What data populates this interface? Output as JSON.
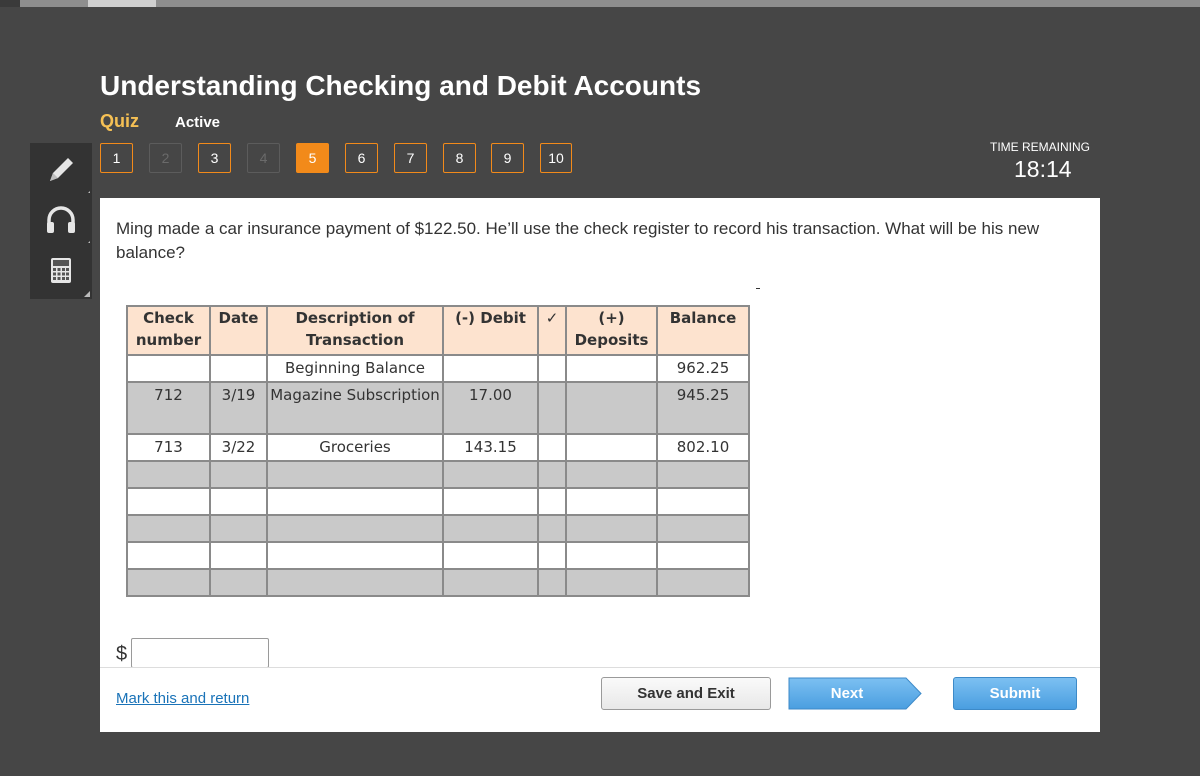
{
  "header": {
    "title": "Understanding Checking and Debit Accounts",
    "section_label": "Quiz",
    "status_label": "Active"
  },
  "question_nav": [
    {
      "label": "1",
      "state": "answered"
    },
    {
      "label": "2",
      "state": "disabled"
    },
    {
      "label": "3",
      "state": "answered"
    },
    {
      "label": "4",
      "state": "disabled"
    },
    {
      "label": "5",
      "state": "current"
    },
    {
      "label": "6",
      "state": "answered"
    },
    {
      "label": "7",
      "state": "answered"
    },
    {
      "label": "8",
      "state": "answered"
    },
    {
      "label": "9",
      "state": "answered"
    },
    {
      "label": "10",
      "state": "answered"
    }
  ],
  "timer": {
    "label": "TIME REMAINING",
    "value": "18:14"
  },
  "tools": [
    {
      "name": "pencil-icon"
    },
    {
      "name": "headphones-icon"
    },
    {
      "name": "calculator-icon"
    }
  ],
  "question": {
    "text": "Ming made a car insurance payment of $122.50. He’ll use the check register to record his  transaction. What will be his new balance?"
  },
  "register": {
    "headers": [
      "Check number",
      "Date",
      "Description of Transaction",
      "(-) Debit",
      "✓",
      "(+) Deposits",
      "Balance"
    ],
    "rows": [
      {
        "check": "",
        "date": "",
        "description": "Beginning Balance",
        "debit": "",
        "mark": "",
        "deposit": "",
        "balance": "962.25"
      },
      {
        "check": "712",
        "date": "3/19",
        "description": "Magazine Subscription",
        "debit": "17.00",
        "mark": "",
        "deposit": "",
        "balance": "945.25"
      },
      {
        "check": "713",
        "date": "3/22",
        "description": "Groceries",
        "debit": "143.15",
        "mark": "",
        "deposit": "",
        "balance": "802.10"
      },
      {
        "check": "",
        "date": "",
        "description": "",
        "debit": "",
        "mark": "",
        "deposit": "",
        "balance": ""
      },
      {
        "check": "",
        "date": "",
        "description": "",
        "debit": "",
        "mark": "",
        "deposit": "",
        "balance": ""
      },
      {
        "check": "",
        "date": "",
        "description": "",
        "debit": "",
        "mark": "",
        "deposit": "",
        "balance": ""
      },
      {
        "check": "",
        "date": "",
        "description": "",
        "debit": "",
        "mark": "",
        "deposit": "",
        "balance": ""
      },
      {
        "check": "",
        "date": "",
        "description": "",
        "debit": "",
        "mark": "",
        "deposit": "",
        "balance": ""
      }
    ]
  },
  "answer": {
    "currency_symbol": "$",
    "value": ""
  },
  "footer": {
    "mark_link": "Mark this and return",
    "save_label": "Save and Exit",
    "next_label": "Next",
    "submit_label": "Submit"
  },
  "colors": {
    "background": "#464646",
    "accent": "#f28a1a",
    "quiz_label": "#f5c054",
    "header_fill": "#fde3cf",
    "row_gray": "#c9c9c9",
    "next_button": "#5aa8e8",
    "link": "#1a73b8"
  }
}
